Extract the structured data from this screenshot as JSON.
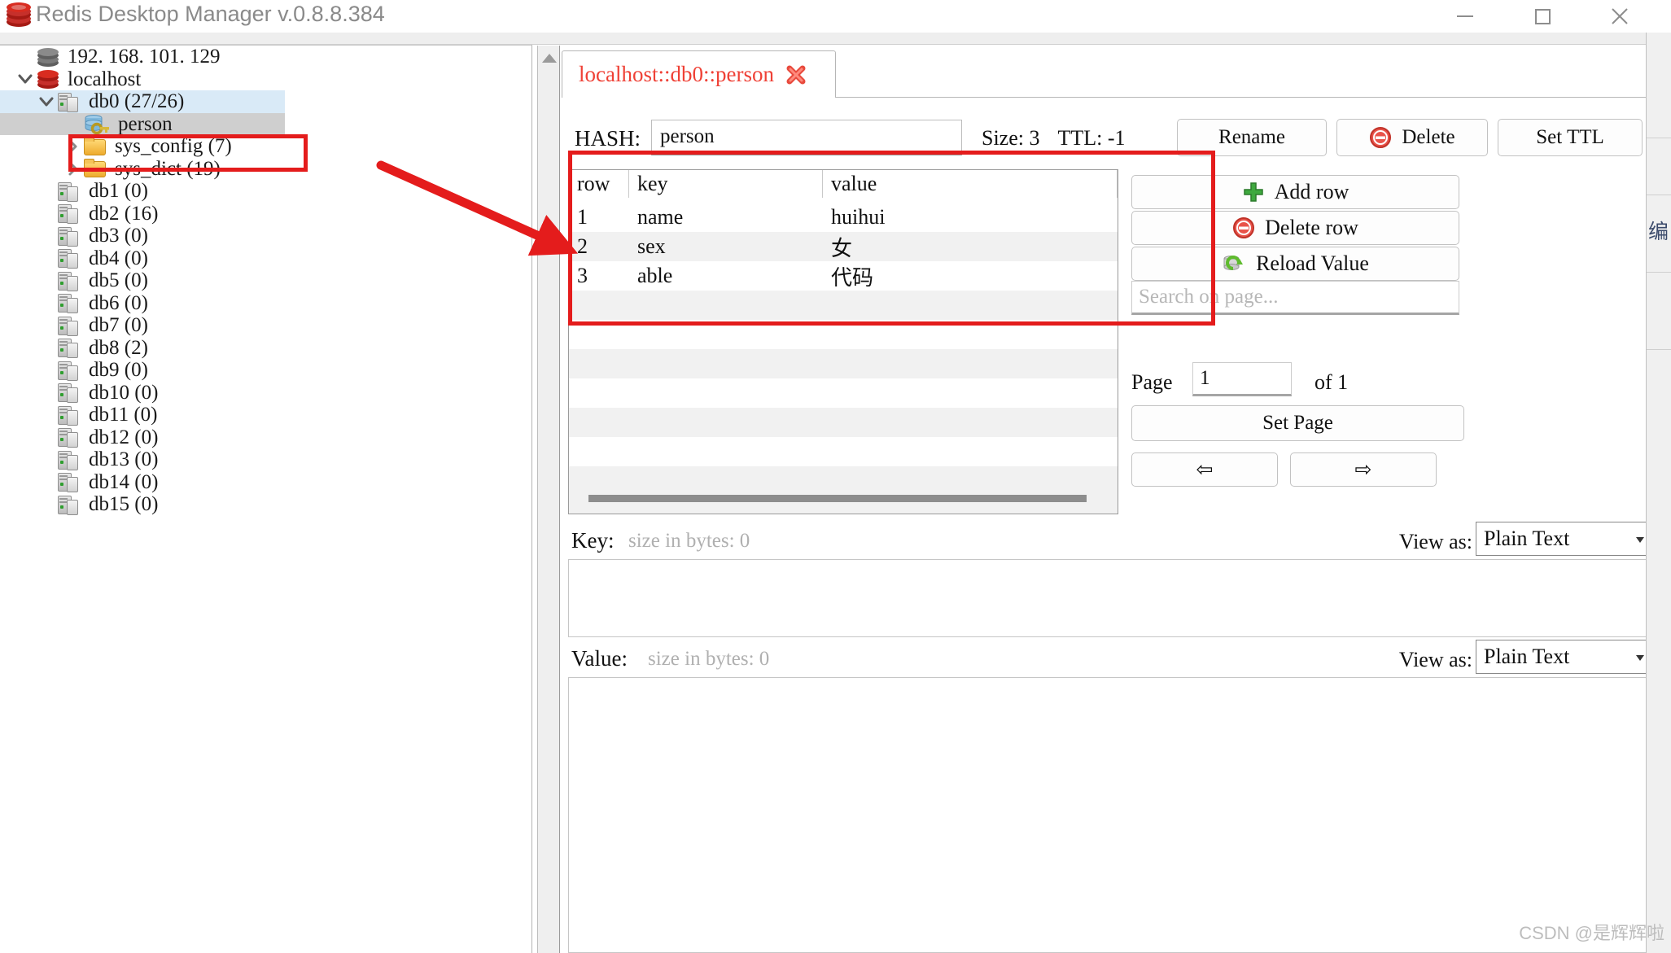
{
  "window": {
    "title": "Redis Desktop Manager v.0.8.8.384",
    "minimize_label": "minimize",
    "maximize_label": "maximize",
    "close_label": "close"
  },
  "sidebar": {
    "items": [
      {
        "label": "192. 168. 101. 129",
        "icon": "server-icon",
        "indent": 0,
        "chevron": "none",
        "state": "normal"
      },
      {
        "label": "localhost",
        "icon": "redis-icon",
        "indent": 0,
        "chevron": "down",
        "state": "normal"
      },
      {
        "label": "db0  (27/26)",
        "icon": "db-icon",
        "indent": 1,
        "chevron": "down",
        "state": "selected-db"
      },
      {
        "label": "person",
        "icon": "key-icon",
        "indent": 2,
        "chevron": "none",
        "state": "selected-key"
      },
      {
        "label": "sys_config (7)",
        "icon": "folder-icon",
        "indent": 2,
        "chevron": "right",
        "state": "normal"
      },
      {
        "label": "sys_dict (19)",
        "icon": "folder-icon",
        "indent": 2,
        "chevron": "right",
        "state": "normal"
      },
      {
        "label": "db1  (0)",
        "icon": "db-icon",
        "indent": 1,
        "chevron": "none",
        "state": "normal"
      },
      {
        "label": "db2  (16)",
        "icon": "db-icon",
        "indent": 1,
        "chevron": "none",
        "state": "normal"
      },
      {
        "label": "db3  (0)",
        "icon": "db-icon",
        "indent": 1,
        "chevron": "none",
        "state": "normal"
      },
      {
        "label": "db4  (0)",
        "icon": "db-icon",
        "indent": 1,
        "chevron": "none",
        "state": "normal"
      },
      {
        "label": "db5  (0)",
        "icon": "db-icon",
        "indent": 1,
        "chevron": "none",
        "state": "normal"
      },
      {
        "label": "db6  (0)",
        "icon": "db-icon",
        "indent": 1,
        "chevron": "none",
        "state": "normal"
      },
      {
        "label": "db7  (0)",
        "icon": "db-icon",
        "indent": 1,
        "chevron": "none",
        "state": "normal"
      },
      {
        "label": "db8  (2)",
        "icon": "db-icon",
        "indent": 1,
        "chevron": "none",
        "state": "normal"
      },
      {
        "label": "db9  (0)",
        "icon": "db-icon",
        "indent": 1,
        "chevron": "none",
        "state": "normal"
      },
      {
        "label": "db10  (0)",
        "icon": "db-icon",
        "indent": 1,
        "chevron": "none",
        "state": "normal"
      },
      {
        "label": "db11  (0)",
        "icon": "db-icon",
        "indent": 1,
        "chevron": "none",
        "state": "normal"
      },
      {
        "label": "db12  (0)",
        "icon": "db-icon",
        "indent": 1,
        "chevron": "none",
        "state": "normal"
      },
      {
        "label": "db13  (0)",
        "icon": "db-icon",
        "indent": 1,
        "chevron": "none",
        "state": "normal"
      },
      {
        "label": "db14  (0)",
        "icon": "db-icon",
        "indent": 1,
        "chevron": "none",
        "state": "normal"
      },
      {
        "label": "db15  (0)",
        "icon": "db-icon",
        "indent": 1,
        "chevron": "none",
        "state": "normal"
      }
    ]
  },
  "tab": {
    "label": "localhost::db0::person",
    "close_icon": "close-x-icon"
  },
  "key_header": {
    "type_label": "HASH:",
    "key_name": "person",
    "size_label": "Size: 3",
    "ttl_label": "TTL: -1",
    "rename_label": "Rename",
    "delete_label": "Delete",
    "set_ttl_label": "Set TTL"
  },
  "table": {
    "columns": [
      "row",
      "key",
      "value"
    ],
    "rows": [
      {
        "row": "1",
        "key": "name",
        "value": "huihui"
      },
      {
        "row": "2",
        "key": "sex",
        "value": "女"
      },
      {
        "row": "3",
        "key": "able",
        "value": "代码"
      }
    ]
  },
  "actions": {
    "add_row_label": "Add row",
    "delete_row_label": "Delete row",
    "reload_value_label": "Reload Value",
    "search_placeholder": "Search on page...",
    "search_value": ""
  },
  "pagination": {
    "page_label": "Page",
    "page_value": "1",
    "of_label": "of 1",
    "set_page_label": "Set Page",
    "prev_label": "⇦",
    "next_label": "⇨"
  },
  "key_editor": {
    "label": "Key:",
    "size_text": "size in bytes: 0",
    "view_as_label": "View as:",
    "view_as_value": "Plain Text",
    "content": ""
  },
  "value_editor": {
    "label": "Value:",
    "size_text": "size in bytes: 0",
    "view_as_label": "View as:",
    "view_as_value": "Plain Text",
    "content": ""
  },
  "far_right": {
    "text": "编"
  },
  "watermark": {
    "text": "CSDN @是辉辉啦"
  },
  "colors": {
    "accent_red": "#ef4136",
    "annotation_red": "#e41c1c",
    "selection_blue": "#d9eaf7",
    "selection_gray": "#cfcfcf"
  }
}
